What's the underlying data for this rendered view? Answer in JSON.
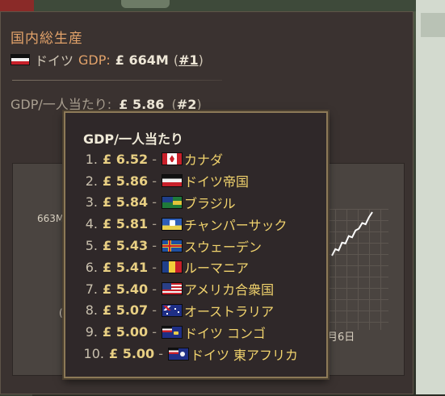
{
  "panel": {
    "title": "国内総生産",
    "country": "ドイツ",
    "gdp_label": "GDP:",
    "gdp_value": "£ 664M",
    "gdp_rank_open": "(",
    "gdp_rank": "#1",
    "gdp_rank_close": ")",
    "per_capita_label": "GDP/一人当たり:",
    "per_capita_value": "£ 5.86",
    "per_capita_rank": "#2"
  },
  "chart": {
    "y_label": "663M",
    "x_label": "月6日",
    "left_glyph": "("
  },
  "tooltip": {
    "title": "GDP/一人当たり",
    "items": [
      {
        "rank": "1.",
        "value": "£ 6.52",
        "country": "カナダ",
        "flag": "canada-flag-icon"
      },
      {
        "rank": "2.",
        "value": "£ 5.86",
        "country": "ドイツ帝国",
        "flag": "german-empire-flag-icon"
      },
      {
        "rank": "3.",
        "value": "£ 5.84",
        "country": "ブラジル",
        "flag": "brazil-flag-icon"
      },
      {
        "rank": "4.",
        "value": "£ 5.81",
        "country": "チャンパーサック",
        "flag": "champasak-flag-icon"
      },
      {
        "rank": "5.",
        "value": "£ 5.43",
        "country": "スウェーデン",
        "flag": "sweden-flag-icon"
      },
      {
        "rank": "6.",
        "value": "£ 5.41",
        "country": "ルーマニア",
        "flag": "romania-flag-icon"
      },
      {
        "rank": "7.",
        "value": "£ 5.40",
        "country": "アメリカ合衆国",
        "flag": "usa-flag-icon"
      },
      {
        "rank": "8.",
        "value": "£ 5.07",
        "country": "オーストラリア",
        "flag": "australia-flag-icon"
      },
      {
        "rank": "9.",
        "value": "£ 5.00",
        "country": "ドイツ コンゴ",
        "flag": "german-congo-flag-icon"
      },
      {
        "rank": "10.",
        "value": "£ 5.00",
        "country": "ドイツ 東アフリカ",
        "flag": "german-east-africa-flag-icon"
      }
    ]
  },
  "colors": {
    "accent": "#e2a26a",
    "gold": "#e8cf83",
    "country_name": "#f1d36d",
    "chart_line": "#ffffff"
  },
  "chart_data": {
    "type": "line",
    "series": [
      {
        "values": [
          0.0,
          0.15,
          0.12,
          0.3,
          0.28,
          0.45,
          0.42,
          0.58,
          0.62,
          0.75,
          0.72,
          0.88,
          1.0
        ]
      }
    ]
  }
}
